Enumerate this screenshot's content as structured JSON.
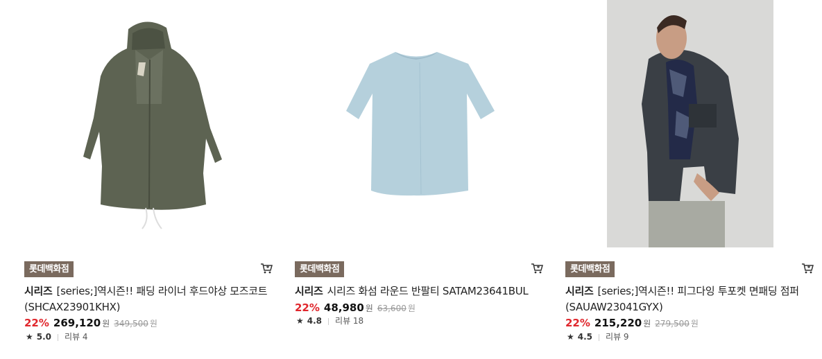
{
  "products": [
    {
      "store": "롯데백화점",
      "brand": "시리즈",
      "name": "[series;]역시즌!! 패딩 라이너 후드야상 모즈코트 (SHCAX23901KHX)",
      "discount": "22%",
      "price": "269,120",
      "currency": "원",
      "original_price": "349,500",
      "rating": "5.0",
      "review_label": "리뷰 4",
      "image_icon": "coat-image"
    },
    {
      "store": "롯데백화점",
      "brand": "시리즈",
      "name": "시리즈 화섬 라운드 반팔티 SATAM23641BUL",
      "discount": "22%",
      "price": "48,980",
      "currency": "원",
      "original_price": "63,600",
      "rating": "4.8",
      "review_label": "리뷰 18",
      "image_icon": "tshirt-image"
    },
    {
      "store": "롯데백화점",
      "brand": "시리즈",
      "name": "[series;]역시즌!! 피그다잉 투포켓 면패딩 점퍼 (SAUAW23041GYX)",
      "discount": "22%",
      "price": "215,220",
      "currency": "원",
      "original_price": "279,500",
      "rating": "4.5",
      "review_label": "리뷰 9",
      "image_icon": "model-jacket-photo"
    }
  ],
  "colors": {
    "badge": "#7a6a5e",
    "discount": "#e0262c",
    "coat": "#5d6352",
    "tshirt": "#b5d0dc"
  }
}
